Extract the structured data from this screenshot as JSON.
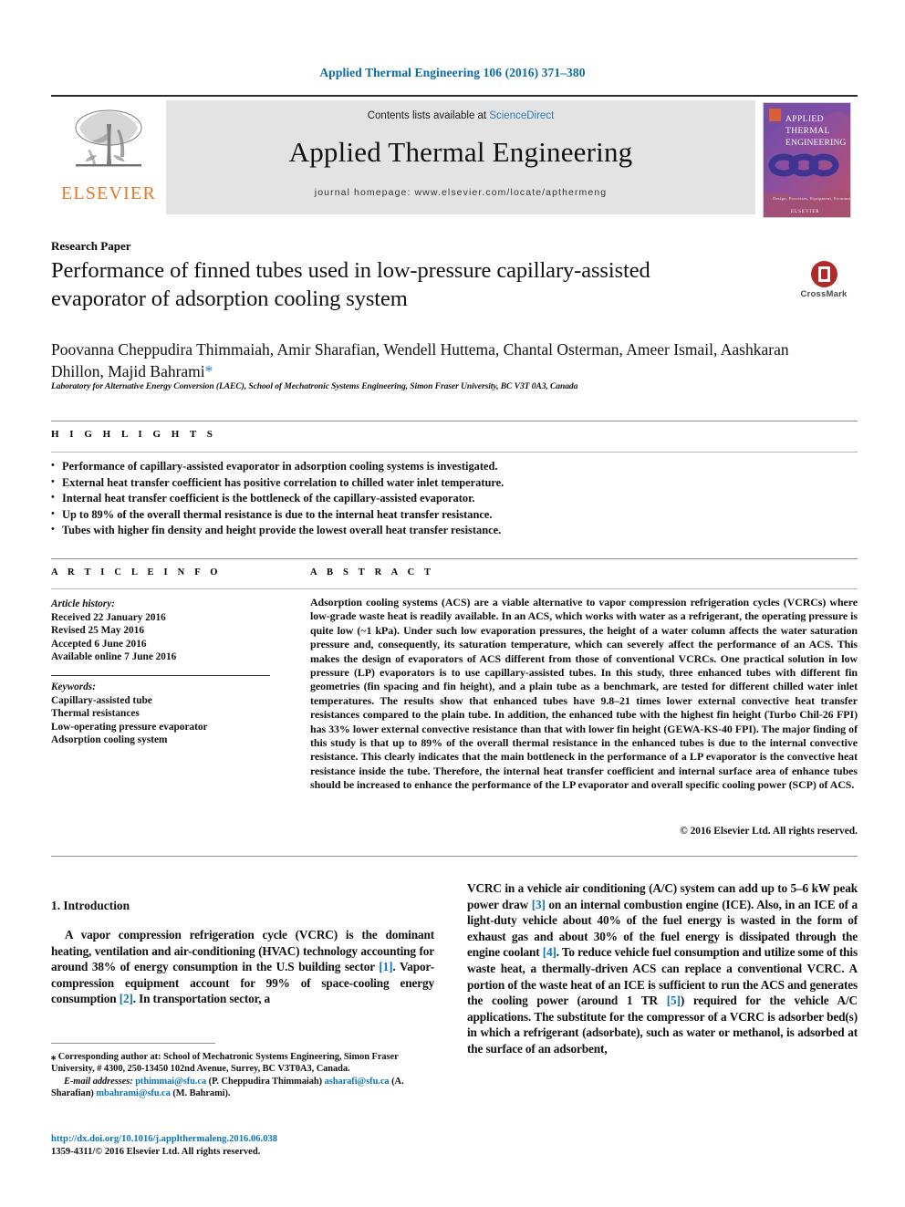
{
  "running_head": "Applied Thermal Engineering 106 (2016) 371–380",
  "masthead": {
    "contents_prefix": "Contents lists available at ",
    "sciencedirect": "ScienceDirect",
    "journal_title": "Applied Thermal Engineering",
    "homepage": "journal homepage: www.elsevier.com/locate/apthermeng",
    "publisher_logo_text": "ELSEVIER",
    "cover": {
      "line1": "APPLIED",
      "line2": "THERMAL",
      "line3": "ENGINEERING",
      "footer": "Design, Processes, Equipment, Economics",
      "brand": "ELSEVIER"
    },
    "accent_color": "#2a7fc1",
    "brand_color": "#e87722"
  },
  "article": {
    "type_label": "Research Paper",
    "title": "Performance of finned tubes used in low-pressure capillary-assisted evaporator of adsorption cooling system",
    "authors": "Poovanna Cheppudira Thimmaiah, Amir Sharafian, Wendell Huttema, Chantal Osterman, Ameer Ismail, Aashkaran Dhillon, Majid Bahrami",
    "corresponding_marker": "*",
    "affiliation": "Laboratory for Alternative Energy Conversion (LAEC), School of Mechatronic Systems Engineering, Simon Fraser University, BC V3T 0A3, Canada",
    "crossmark_label": "CrossMark"
  },
  "highlights": {
    "heading": "H I G H L I G H T S",
    "items": [
      "Performance of capillary-assisted evaporator in adsorption cooling systems is investigated.",
      "External heat transfer coefficient has positive correlation to chilled water inlet temperature.",
      "Internal heat transfer coefficient is the bottleneck of the capillary-assisted evaporator.",
      "Up to 89% of the overall thermal resistance is due to the internal heat transfer resistance.",
      "Tubes with higher fin density and height provide the lowest overall heat transfer resistance."
    ]
  },
  "article_info": {
    "heading": "A R T I C L E    I N F O",
    "history_label": "Article history:",
    "history": [
      "Received 22 January 2016",
      "Revised 25 May 2016",
      "Accepted 6 June 2016",
      "Available online 7 June 2016"
    ],
    "keywords_label": "Keywords:",
    "keywords": [
      "Capillary-assisted tube",
      "Thermal resistances",
      "Low-operating pressure evaporator",
      "Adsorption cooling system"
    ]
  },
  "abstract": {
    "heading": "A B S T R A C T",
    "text": "Adsorption cooling systems (ACS) are a viable alternative to vapor compression refrigeration cycles (VCRCs) where low-grade waste heat is readily available. In an ACS, which works with water as a refrigerant, the operating pressure is quite low (~1 kPa). Under such low evaporation pressures, the height of a water column affects the water saturation pressure and, consequently, its saturation temperature, which can severely affect the performance of an ACS. This makes the design of evaporators of ACS different from those of conventional VCRCs. One practical solution in low pressure (LP) evaporators is to use capillary-assisted tubes. In this study, three enhanced tubes with different fin geometries (fin spacing and fin height), and a plain tube as a benchmark, are tested for different chilled water inlet temperatures. The results show that enhanced tubes have 9.8–21 times lower external convective heat transfer resistances compared to the plain tube. In addition, the enhanced tube with the highest fin height (Turbo Chil-26 FPI) has 33% lower external convective resistance than that with lower fin height (GEWA-KS-40 FPI). The major finding of this study is that up to 89% of the overall thermal resistance in the enhanced tubes is due to the internal convective resistance. This clearly indicates that the main bottleneck in the performance of a LP evaporator is the convective heat resistance inside the tube. Therefore, the internal heat transfer coefficient and internal surface area of enhance tubes should be increased to enhance the performance of the LP evaporator and overall specific cooling power (SCP) of ACS.",
    "copyright": "© 2016 Elsevier Ltd. All rights reserved."
  },
  "body": {
    "section_number_title": "1. Introduction",
    "left_paragraph_parts": {
      "p1_a": "A vapor compression refrigeration cycle (VCRC) is the dominant heating, ventilation and air-conditioning (HVAC) technology accounting for around 38% of energy consumption in the U.S building sector ",
      "ref1": "[1]",
      "p1_b": ". Vapor-compression equipment account for 99% of space-cooling energy consumption ",
      "ref2": "[2]",
      "p1_c": ". In transportation sector, a"
    },
    "right_paragraph_parts": {
      "p_a": "VCRC in a vehicle air conditioning (A/C) system can add up to 5–6 kW peak power draw ",
      "ref3": "[3]",
      "p_b": " on an internal combustion engine (ICE). Also, in an ICE of a light-duty vehicle about 40% of the fuel energy is wasted in the form of exhaust gas and about 30% of the fuel energy is dissipated through the engine coolant ",
      "ref4": "[4]",
      "p_c": ". To reduce vehicle fuel consumption and utilize some of this waste heat, a thermally-driven ACS can replace a conventional VCRC. A portion of the waste heat of an ICE is sufficient to run the ACS and generates the cooling power (around 1 TR ",
      "ref5": "[5]",
      "p_d": ") required for the vehicle A/C applications. The substitute for the compressor of a VCRC is adsorber bed(s) in which a refrigerant (adsorbate), such as water or methanol, is adsorbed at the surface of an adsorbent,"
    }
  },
  "footnotes": {
    "corresponding_marker": "⁎",
    "corresponding_text": " Corresponding author at: School of Mechatronic Systems Engineering, Simon Fraser University, # 4300, 250-13450 102nd Avenue, Surrey, BC V3T0A3, Canada.",
    "email_label": "E-mail addresses:",
    "emails": [
      {
        "address": "pthimmai@sfu.ca",
        "name": "(P. Cheppudira Thimmaiah)"
      },
      {
        "address": "asharafi@sfu.ca",
        "name": "(A. Sharafian)"
      },
      {
        "address": "mbahrami@sfu.ca",
        "name": "(M. Bahrami)."
      }
    ],
    "doi": "http://dx.doi.org/10.1016/j.applthermaleng.2016.06.038",
    "issn_line": "1359-4311/© 2016 Elsevier Ltd. All rights reserved."
  }
}
